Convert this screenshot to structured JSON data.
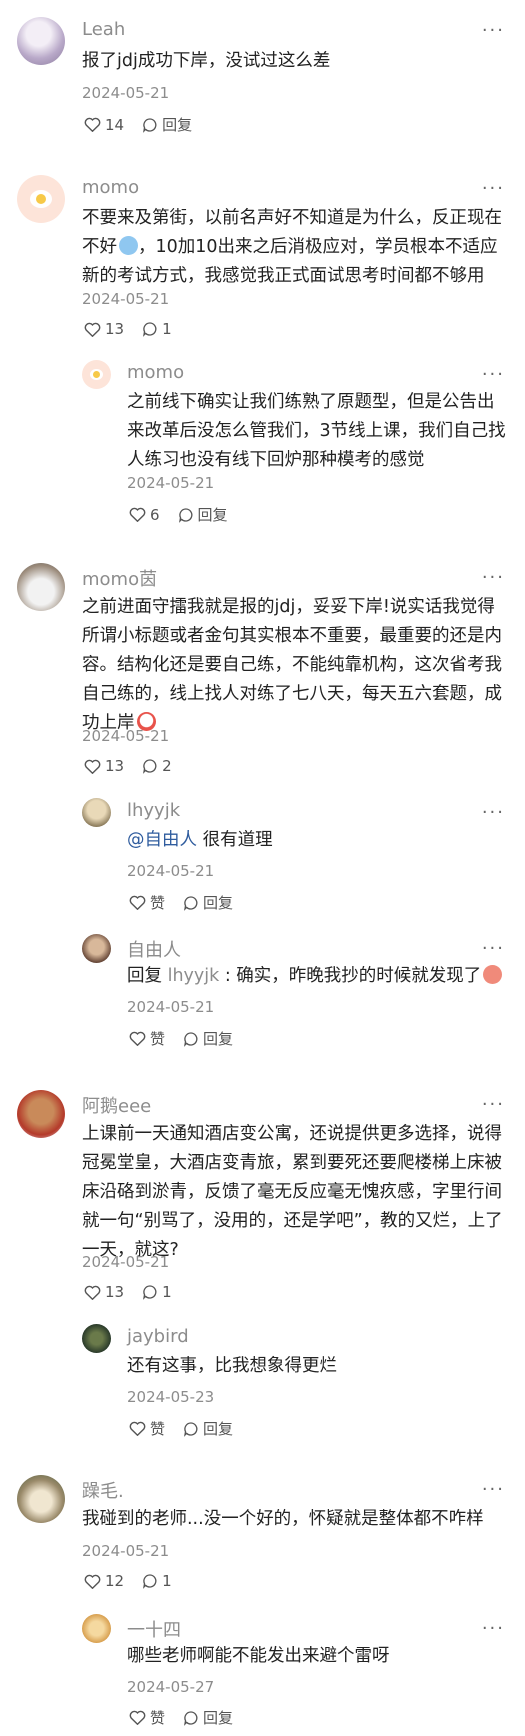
{
  "more_label": "···",
  "comments": [
    {
      "name": "Leah",
      "lines": [
        "报了jdj成功下岸，没试过这么差"
      ],
      "date": "2024-05-21",
      "likes": "14",
      "reply_label": "回复"
    },
    {
      "name": "momo",
      "lines": [
        "不要来及第街，以前名声好不知道是为什么，反正现在",
        "不好",
        "，10加10出来之后消极应对，学员根本不适应",
        "新的考试方式，我感觉我正式面试思考时间都不够用"
      ],
      "date": "2024-05-21",
      "likes": "13",
      "replies": "1",
      "reply_label": "回复",
      "replies_list": [
        {
          "name": "momo",
          "lines": [
            "之前线下确实让我们练熟了原题型，但是公告出",
            "来改革后没怎么管我们，3节线上课，我们自己找",
            "人练习也没有线下回炉那种模考的感觉"
          ],
          "date": "2024-05-21",
          "likes": "6",
          "reply_label": "回复"
        }
      ]
    },
    {
      "name": "momo茵",
      "lines": [
        "之前进面守擂我就是报的jdj，妥妥下岸!说实话我觉得",
        "所谓小标题或者金句其实根本不重要，最重要的还是内",
        "容。结构化还是要自己练，不能纯靠机构，这次省考我",
        "自己练的，线上找人对练了七八天，每天五六套题，成",
        "功上岸"
      ],
      "date": "2024-05-21",
      "likes": "13",
      "replies": "2",
      "reply_label": "回复",
      "replies_list": [
        {
          "name": "lhyyjk",
          "mention": "@自由人",
          "text_after": " 很有道理",
          "date": "2024-05-21",
          "like_label": "赞",
          "reply_label": "回复"
        },
        {
          "name": "自由人",
          "reply_prefix": "回复 ",
          "reply_target": "lhyyjk",
          "text_after": " : 确实，昨晚我抄的时候就发现了",
          "date": "2024-05-21",
          "like_label": "赞",
          "reply_label": "回复"
        }
      ]
    },
    {
      "name": "阿鹅eee",
      "lines": [
        "上课前一天通知酒店变公寓，还说提供更多选择，说得",
        "冠冕堂皇，大酒店变青旅，累到要死还要爬楼梯上床被",
        "床沿硌到淤青，反馈了毫无反应毫无愧疚感，字里行间",
        "就一句“别骂了，没用的，还是学吧”，教的又烂，上了",
        "一天，就这?"
      ],
      "date": "2024-05-21",
      "likes": "13",
      "replies": "1",
      "reply_label": "回复",
      "replies_list": [
        {
          "name": "jaybird",
          "lines": [
            "还有这事，比我想象得更烂"
          ],
          "date": "2024-05-23",
          "like_label": "赞",
          "reply_label": "回复"
        }
      ]
    },
    {
      "name": "躁毛.",
      "lines": [
        "我碰到的老师...没一个好的，怀疑就是整体都不咋样"
      ],
      "date": "2024-05-21",
      "likes": "12",
      "replies": "1",
      "reply_label": "回复",
      "replies_list": [
        {
          "name": "一十四",
          "lines": [
            "哪些老师啊能不能发出来避个雷呀"
          ],
          "date": "2024-05-27",
          "like_label": "赞",
          "reply_label": "回复"
        }
      ]
    }
  ]
}
